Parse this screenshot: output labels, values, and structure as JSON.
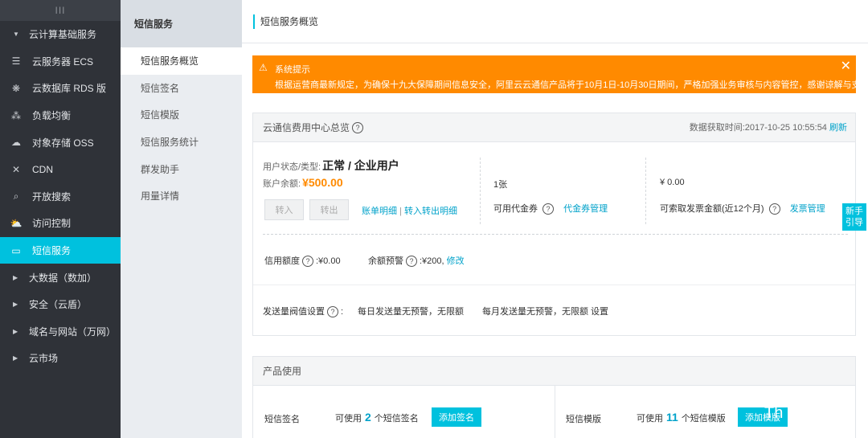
{
  "nav": {
    "top": "III",
    "items": [
      {
        "label": "云计算基础服务",
        "type": "group",
        "caret": "▼",
        "icon": "caret-down-icon"
      },
      {
        "label": "云服务器 ECS",
        "icon": "server-icon",
        "glyph": "☰"
      },
      {
        "label": "云数据库 RDS 版",
        "icon": "database-icon",
        "glyph": "❋"
      },
      {
        "label": "负载均衡",
        "icon": "load-balancer-icon",
        "glyph": "⁂"
      },
      {
        "label": "对象存储 OSS",
        "icon": "cloud-upload-icon",
        "glyph": "☁"
      },
      {
        "label": "CDN",
        "icon": "cdn-icon",
        "glyph": "✕"
      },
      {
        "label": "开放搜索",
        "icon": "search-icon",
        "glyph": "⌕"
      },
      {
        "label": "访问控制",
        "icon": "cloud-lock-icon",
        "glyph": "⛅"
      },
      {
        "label": "短信服务",
        "icon": "message-icon",
        "glyph": "▭",
        "active": true
      },
      {
        "label": "大数据（数加）",
        "type": "group",
        "caret": "▶",
        "icon": "caret-right-icon"
      },
      {
        "label": "安全（云盾）",
        "type": "group",
        "caret": "▶",
        "icon": "caret-right-icon"
      },
      {
        "label": "域名与网站（万网）",
        "type": "group",
        "caret": "▶",
        "icon": "caret-right-icon"
      },
      {
        "label": "云市场",
        "type": "group",
        "caret": "▶",
        "icon": "caret-right-icon"
      }
    ]
  },
  "subnav": {
    "title": "短信服务",
    "items": [
      "短信服务概览",
      "短信签名",
      "短信模版",
      "短信服务统计",
      "群发助手",
      "用量详情"
    ]
  },
  "page": {
    "title": "短信服务概览"
  },
  "alert": {
    "title": "系统提示",
    "text": "根据运营商最新规定，为确保十九大保障期间信息安全，阿里云云通信产品将于10月1日-10月30日期间，严格加强业务审核与内容管控，感谢谅解与支持！",
    "close": "✕",
    "warn": "⚠"
  },
  "overview": {
    "title": "云通信费用中心总览",
    "fetch_label": "数据获取时间:",
    "fetch_time": "2017-10-25 10:55:54",
    "refresh": "刷新",
    "status_label": "用户状态/类型:",
    "status_value": "正常 / 企业用户",
    "balance_label": "账户余额:",
    "balance_value": "¥500.00",
    "btn_in": "转入",
    "btn_out": "转出",
    "bill_link": "账单明细",
    "sep": "|",
    "transfer_link": "转入转出明细",
    "voucher_count": "1张",
    "voucher_label": "可用代金券",
    "voucher_link": "代金券管理",
    "invoice_amount": "¥ 0.00",
    "invoice_label": "可索取发票金额(近12个月)",
    "invoice_link": "发票管理",
    "credit_label": "信用额度",
    "credit_value": ":¥0.00",
    "warn_label": "余额预警",
    "warn_value": ":¥200,",
    "warn_edit": "修改",
    "threshold_label": "发送量阀值设置",
    "threshold_colon": ":",
    "daily": "每日发送量无预警，无限额",
    "monthly": "每月发送量无预警，无限额",
    "settings": "设置"
  },
  "product": {
    "title": "产品使用",
    "sign_label": "短信签名",
    "sign_pre": "可使用",
    "sign_count": "2",
    "sign_post": "个短信签名",
    "sign_btn": "添加签名",
    "tpl_label": "短信模版",
    "tpl_pre": "可使用",
    "tpl_count": "11",
    "tpl_post": "个短信模版",
    "tpl_btn": "添加模版"
  },
  "guide": "新手引导",
  "question": "?",
  "watermark": "Th"
}
